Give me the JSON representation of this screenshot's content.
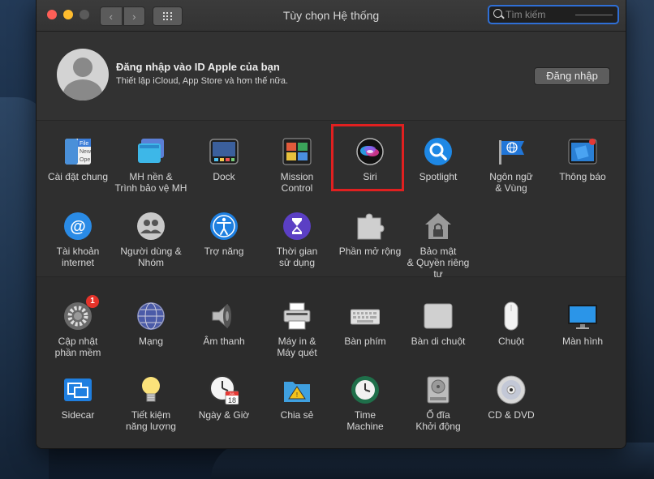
{
  "window": {
    "title": "Tùy chọn Hệ thống",
    "search_placeholder": "Tìm kiếm"
  },
  "account": {
    "title": "Đăng nhập vào ID Apple của bạn",
    "subtitle": "Thiết lập iCloud, App Store và hơn thế nữa.",
    "login_label": "Đăng nhập"
  },
  "section1": {
    "items": [
      {
        "label": "Cài đặt chung",
        "icon": "general-icon"
      },
      {
        "label": "MH nền &\nTrình bảo vệ MH",
        "icon": "desktop-screensaver-icon"
      },
      {
        "label": "Dock",
        "icon": "dock-icon"
      },
      {
        "label": "Mission\nControl",
        "icon": "mission-control-icon"
      },
      {
        "label": "Siri",
        "icon": "siri-icon"
      },
      {
        "label": "Spotlight",
        "icon": "spotlight-icon"
      },
      {
        "label": "Ngôn ngữ\n& Vùng",
        "icon": "language-region-icon"
      },
      {
        "label": "Thông báo",
        "icon": "notifications-icon"
      },
      {
        "label": "Tài khoản\ninternet",
        "icon": "internet-accounts-icon"
      },
      {
        "label": "Người dùng &\nNhóm",
        "icon": "users-groups-icon"
      },
      {
        "label": "Trợ năng",
        "icon": "accessibility-icon"
      },
      {
        "label": "Thời gian\nsử dụng",
        "icon": "screen-time-icon"
      },
      {
        "label": "Phần mở rộng",
        "icon": "extensions-icon"
      },
      {
        "label": "Bảo mật\n& Quyền riêng tư",
        "icon": "security-privacy-icon"
      }
    ]
  },
  "section2": {
    "items": [
      {
        "label": "Cập nhật\nphần mềm",
        "icon": "software-update-icon",
        "badge": "1"
      },
      {
        "label": "Mạng",
        "icon": "network-icon"
      },
      {
        "label": "Âm thanh",
        "icon": "sound-icon"
      },
      {
        "label": "Máy in &\nMáy quét",
        "icon": "printers-scanners-icon"
      },
      {
        "label": "Bàn phím",
        "icon": "keyboard-icon"
      },
      {
        "label": "Bàn di chuột",
        "icon": "trackpad-icon"
      },
      {
        "label": "Chuột",
        "icon": "mouse-icon"
      },
      {
        "label": "Màn hình",
        "icon": "displays-icon"
      },
      {
        "label": "Sidecar",
        "icon": "sidecar-icon"
      },
      {
        "label": "Tiết kiệm\nnăng lượng",
        "icon": "energy-saver-icon"
      },
      {
        "label": "Ngày & Giờ",
        "icon": "date-time-icon"
      },
      {
        "label": "Chia sẻ",
        "icon": "sharing-icon"
      },
      {
        "label": "Time\nMachine",
        "icon": "time-machine-icon"
      },
      {
        "label": "Ổ đĩa\nKhởi động",
        "icon": "startup-disk-icon"
      },
      {
        "label": "CD & DVD",
        "icon": "cd-dvd-icon"
      }
    ]
  },
  "date_icon": {
    "month": "JUL",
    "day": "18"
  },
  "colors": {
    "highlight": "#e02020",
    "search_focus": "#2f6fd6",
    "badge": "#e5332a"
  }
}
